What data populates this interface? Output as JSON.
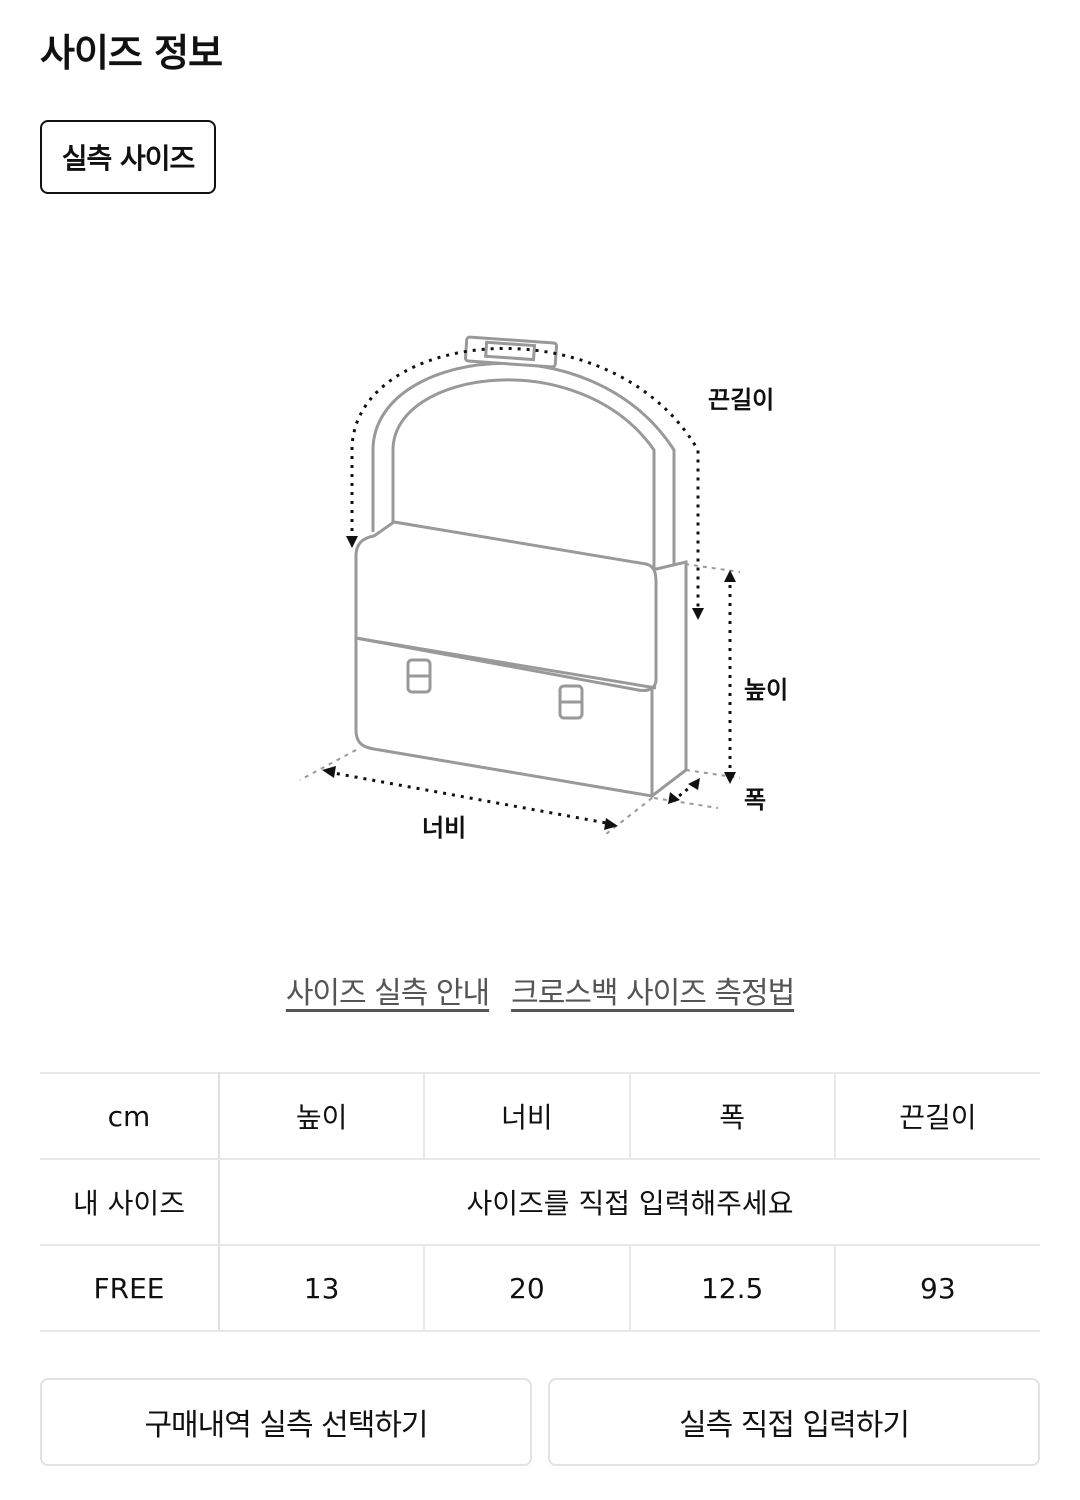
{
  "header": {
    "title": "사이즈 정보"
  },
  "tabs": {
    "active_label": "실측 사이즈"
  },
  "diagram": {
    "labels": {
      "strap": "끈길이",
      "height": "높이",
      "depth": "폭",
      "width": "너비"
    }
  },
  "links": [
    {
      "label": "사이즈 실측 안내"
    },
    {
      "label": "크로스백 사이즈 측정법"
    }
  ],
  "table": {
    "unit": "cm",
    "columns": [
      "높이",
      "너비",
      "폭",
      "끈길이"
    ],
    "my_size": {
      "label": "내 사이즈",
      "hint": "사이즈를 직접 입력해주세요"
    },
    "rows": [
      {
        "label": "FREE",
        "values": [
          "13",
          "20",
          "12.5",
          "93"
        ]
      }
    ]
  },
  "actions": {
    "history_label": "구매내역 실측 선택하기",
    "manual_label": "실측 직접 입력하기"
  }
}
